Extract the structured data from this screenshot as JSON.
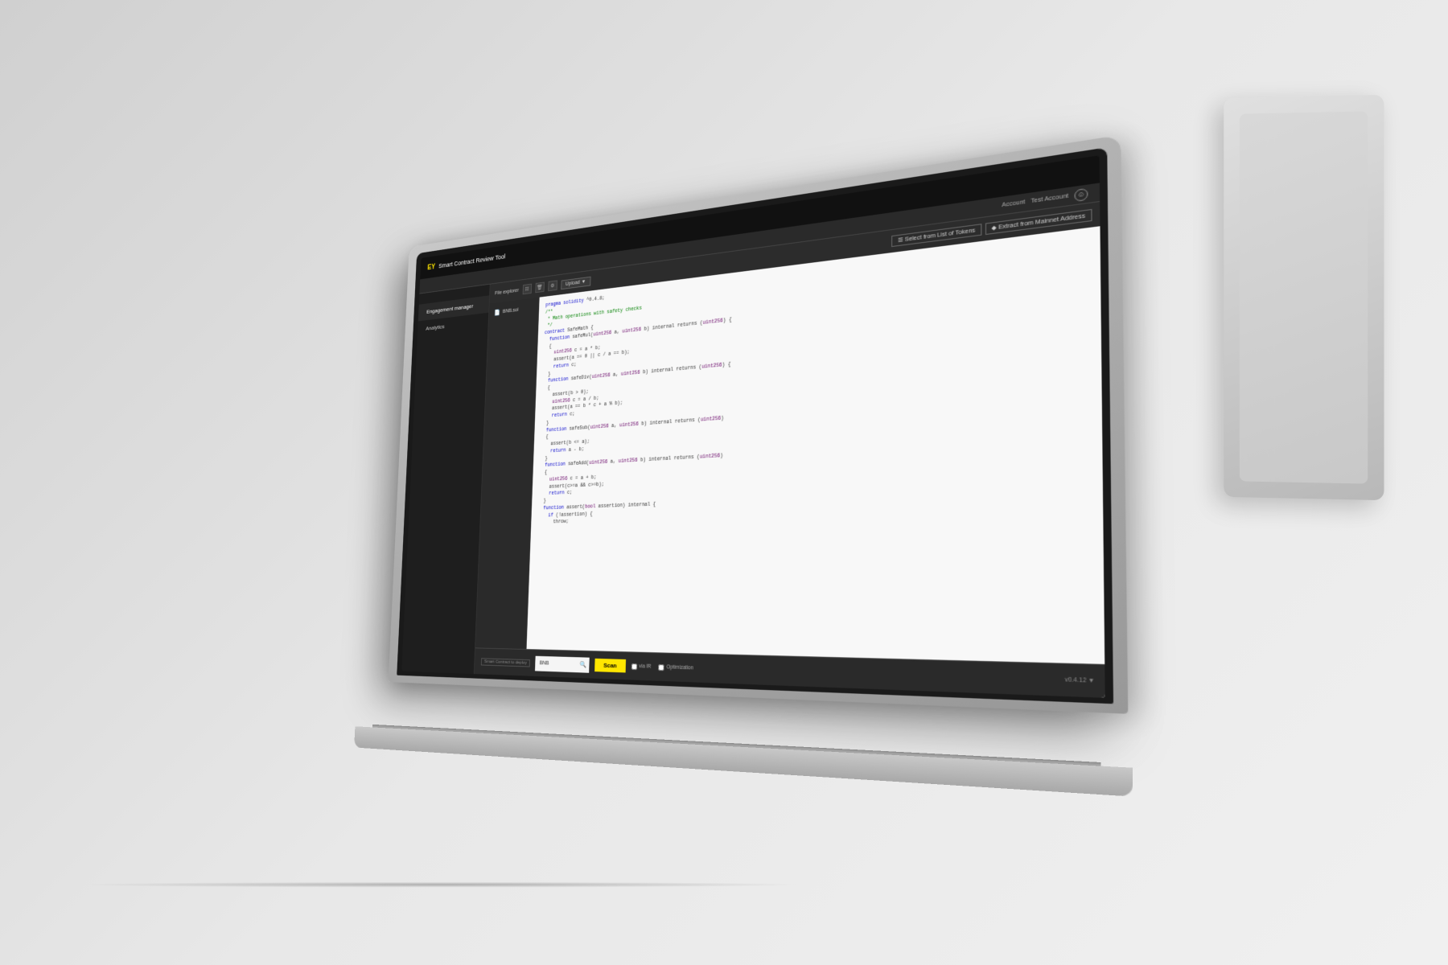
{
  "app": {
    "logo": "EY",
    "title": "Smart Contract Review Tool",
    "account_label": "Account",
    "account_name": "Test Account"
  },
  "sidebar": {
    "items": [
      {
        "label": "Engagement manager",
        "active": true
      },
      {
        "label": "Analytics",
        "active": false
      }
    ]
  },
  "toolbar": {
    "file_explorer_label": "File explorer",
    "upload_label": "Upload ▼",
    "select_label": "Select from List of Tokens",
    "extract_label": "Extract from Mainnet Address"
  },
  "file_list": {
    "files": [
      {
        "name": "BNB.sol"
      }
    ]
  },
  "code": {
    "lines": [
      "pragma solidity ^0.4.8;",
      "",
      "/**",
      " * Math operations with safety checks",
      " */",
      "contract SafeMath {",
      "  function safeMul(uint256 a, uint256 b) internal returns (uint256) {",
      "  {",
      "    uint256 c = a * b;",
      "    assert(a == 0 || c / a == b);",
      "    return c;",
      "  }",
      "",
      "",
      "  function safeDiv(uint256 a, uint256 b) internal returns (uint256) {",
      "  {",
      "    assert(b > 0);",
      "    uint256 c = a / b;",
      "    assert(a == b * c + a % b);",
      "    return c;",
      "  }",
      "",
      "  function safeSub(uint256 a, uint256 b) internal returns (uint256)",
      "  {",
      "    assert(b <= a);",
      "    return a - b;",
      "  }",
      "",
      "",
      "  function safeAdd(uint256 a, uint256 b) internal returns (uint256)",
      "  {",
      "    uint256 c = a + b;",
      "    assert(c>=a && c>=b);",
      "    return c;",
      "  }",
      "",
      "  function assert(bool assertion) internal {",
      "    if (!assertion) {",
      "      throw;"
    ]
  },
  "bottom": {
    "deploy_label": "Smart Contract to deploy",
    "search_value": "BNB",
    "search_placeholder": "BNB",
    "scan_label": "Scan",
    "via_ir_label": "via IR",
    "optimization_label": "Optimization",
    "version_label": "v0.4.12 ▼"
  }
}
